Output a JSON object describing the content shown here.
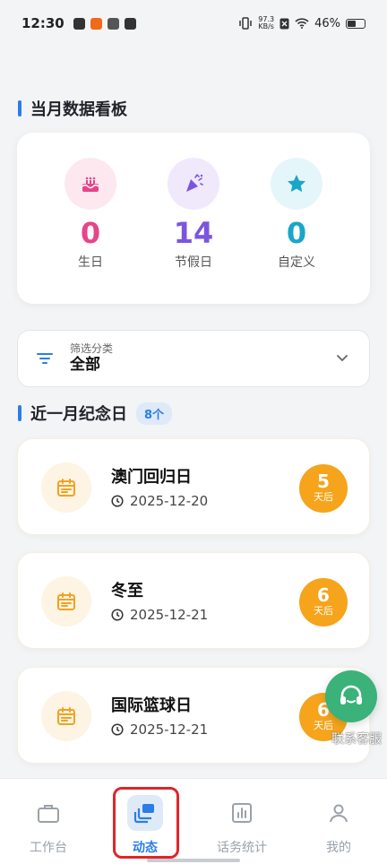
{
  "status_bar": {
    "time": "12:30",
    "net_speed_value": "97.3",
    "net_speed_unit": "KB/s",
    "battery": "46%"
  },
  "board": {
    "title": "当月数据看板",
    "stats": [
      {
        "value": "0",
        "label": "生日",
        "color": "#e5468a",
        "icon_bg": "#fde8f0",
        "icon": "cake-icon"
      },
      {
        "value": "14",
        "label": "节假日",
        "color": "#7b55e0",
        "icon_bg": "#efe9fb",
        "icon": "party-popper-icon"
      },
      {
        "value": "0",
        "label": "自定义",
        "color": "#1aa6c8",
        "icon_bg": "#e5f6fa",
        "icon": "star-icon"
      }
    ]
  },
  "filter": {
    "caption": "筛选分类",
    "value": "全部"
  },
  "events": {
    "title": "近一月纪念日",
    "count": "8个",
    "items": [
      {
        "name": "澳门回归日",
        "date": "2025-12-20",
        "days": "5",
        "unit": "天后"
      },
      {
        "name": "冬至",
        "date": "2025-12-21",
        "days": "6",
        "unit": "天后"
      },
      {
        "name": "国际篮球日",
        "date": "2025-12-21",
        "days": "6",
        "unit": "天后"
      }
    ]
  },
  "customer_service": {
    "label": "联系客服"
  },
  "tabbar": {
    "tabs": [
      {
        "label": "工作台",
        "icon": "briefcase-icon"
      },
      {
        "label": "动态",
        "icon": "layers-icon",
        "active": true
      },
      {
        "label": "话务统计",
        "icon": "bar-chart-icon"
      },
      {
        "label": "我的",
        "icon": "user-icon"
      }
    ]
  },
  "colors": {
    "accent": "#2b7de9",
    "event_orange": "#f5a41c",
    "highlight_red": "#e0242b",
    "cs_green": "#3ab27a"
  }
}
